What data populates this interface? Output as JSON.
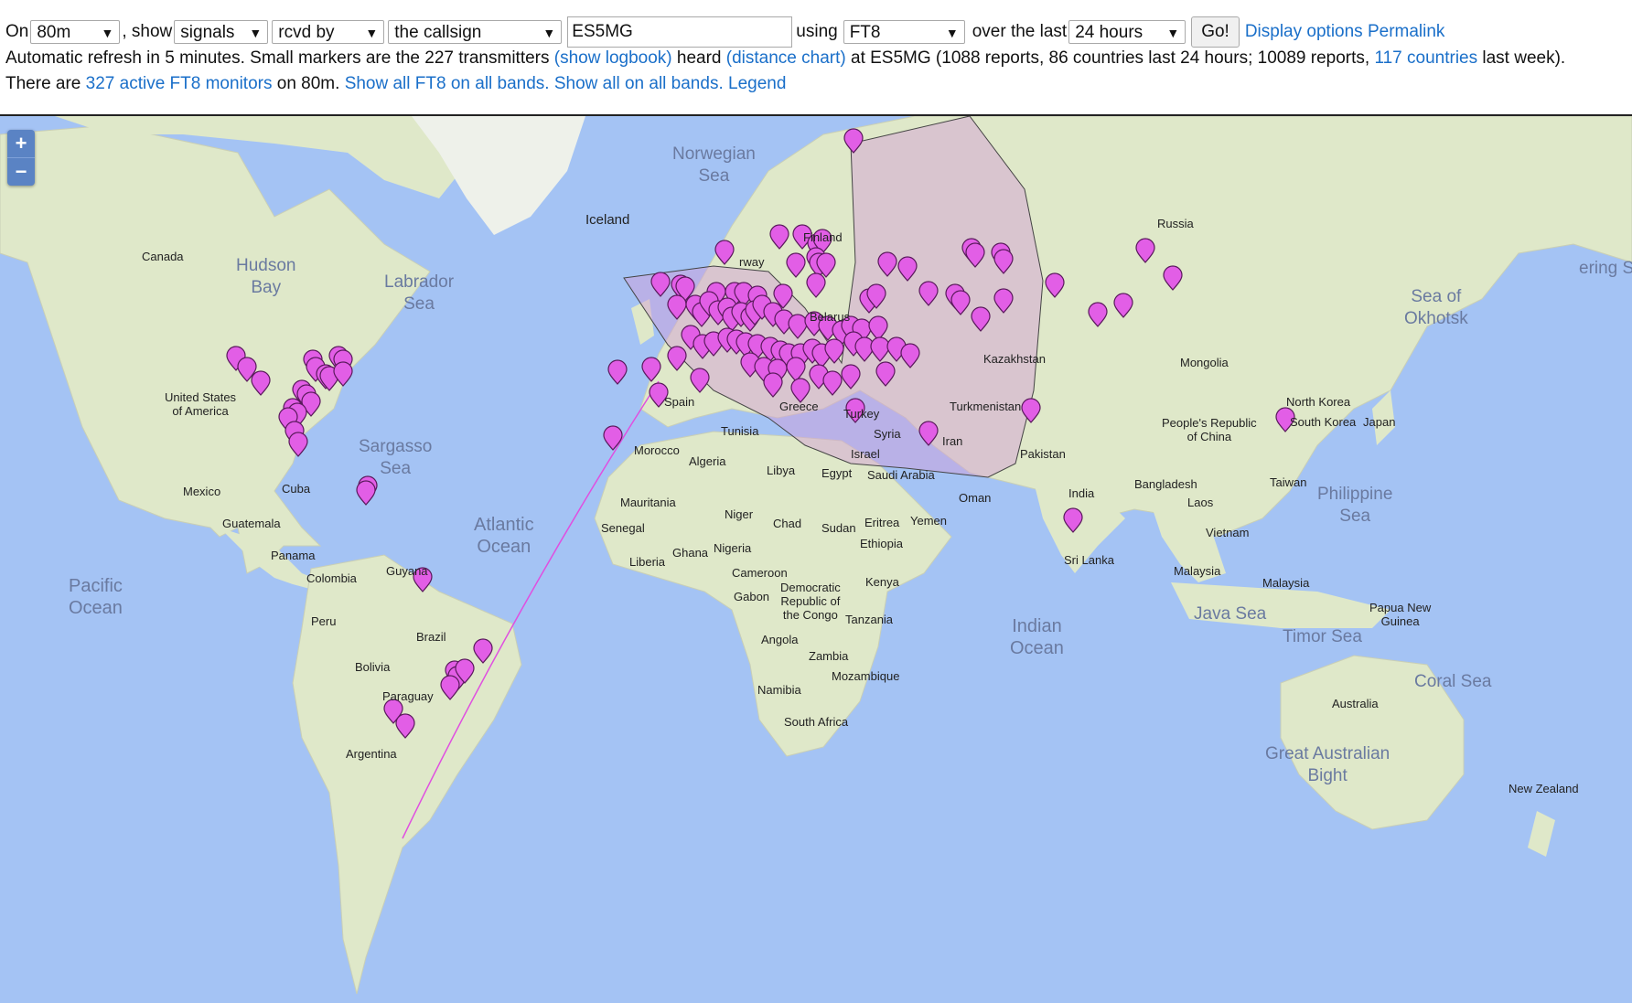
{
  "controls": {
    "on_label": "On",
    "band": "80m",
    "show_label": ", show",
    "show_value": "signals",
    "direction": "rcvd by",
    "subject": "the callsign",
    "callsign": "ES5MG",
    "using_label": "using",
    "mode": "FT8",
    "over_label": "over the last",
    "period": "24 hours",
    "go_label": "Go!",
    "display_options": "Display options",
    "permalink": "Permalink"
  },
  "status": {
    "line1_a": "Automatic refresh in 5 minutes. Small markers are the 227 transmitters ",
    "show_logbook": "(show logbook)",
    "line1_b": " heard ",
    "distance_chart": "(distance chart)",
    "line1_c": " at ES5MG (1088 reports, 86 countries last 24 hours; 10089 reports, ",
    "countries_link": "117 countries",
    "line1_d": " last week).",
    "line2_a": "There are ",
    "monitors_link": "327 active FT8 monitors",
    "line2_b": " on 80m. ",
    "show_ft8_all": "Show all FT8 on all bands.",
    "show_all_all": "Show all on all bands.",
    "legend": "Legend"
  },
  "map": {
    "zoom_in": "+",
    "zoom_out": "−",
    "colors": {
      "water": "#a4c3f4",
      "land": "#dfe8c9",
      "marker": "#e25ee6",
      "marker_outline": "#5a1a5c",
      "range": "#d29bd8"
    },
    "place_labels": {
      "norwegian_sea": "Norwegian\nSea",
      "iceland": "Iceland",
      "hudson_bay": "Hudson\nBay",
      "labrador_sea": "Labrador\nSea",
      "canada": "Canada",
      "usa": "United States\nof America",
      "sargasso_sea": "Sargasso\nSea",
      "mexico": "Mexico",
      "cuba": "Cuba",
      "guatemala": "Guatemala",
      "panama": "Panama",
      "pacific_ocean": "Pacific\nOcean",
      "atlantic_ocean": "Atlantic\nOcean",
      "colombia": "Colombia",
      "guyana": "Guyana",
      "peru": "Peru",
      "brazil": "Brazil",
      "bolivia": "Bolivia",
      "paraguay": "Paraguay",
      "argentina": "Argentina",
      "finland": "Finland",
      "belarus": "Belarus",
      "russia": "Russia",
      "kazakhstan": "Kazakhstan",
      "turkmenistan": "Turkmenistan",
      "mongolia": "Mongolia",
      "syria": "Syria",
      "iran": "Iran",
      "israel": "Israel",
      "pakistan": "Pakistan",
      "tunisia": "Tunisia",
      "morocco": "Morocco",
      "algeria": "Algeria",
      "libya": "Libya",
      "egypt": "Egypt",
      "saudi_arabia": "Saudi Arabia",
      "oman": "Oman",
      "yemen": "Yemen",
      "mauritania": "Mauritania",
      "senegal": "Senegal",
      "niger": "Niger",
      "chad": "Chad",
      "sudan": "Sudan",
      "eritrea": "Eritrea",
      "ethiopia": "Ethiopia",
      "nigeria": "Nigeria",
      "ghana": "Ghana",
      "liberia": "Liberia",
      "cameroon": "Cameroon",
      "gabon": "Gabon",
      "drc": "Democratic\nRepublic of\nthe Congo",
      "kenya": "Kenya",
      "tanzania": "Tanzania",
      "angola": "Angola",
      "zambia": "Zambia",
      "mozambique": "Mozambique",
      "namibia": "Namibia",
      "south_africa": "South Africa",
      "india": "India",
      "sri_lanka": "Sri Lanka",
      "bangladesh": "Bangladesh",
      "laos": "Laos",
      "vietnam": "Vietnam",
      "china": "People's Republic\nof China",
      "north_korea": "North Korea",
      "south_korea": "South Korea",
      "japan": "Japan",
      "taiwan": "Taiwan",
      "philippine_sea": "Philippine\nSea",
      "sea_of_okhotsk": "Sea of\nOkhotsk",
      "bering": "ering Se",
      "malaysia1": "Malaysia",
      "malaysia2": "Malaysia",
      "java_sea": "Java Sea",
      "timor_sea": "Timor Sea",
      "png": "Papua New\nGuinea",
      "coral_sea": "Coral Sea",
      "australia": "Australia",
      "great_australian_bight": "Great Australian\nBight",
      "new_zealand": "New Zealand",
      "indian_ocean": "Indian\nOcean",
      "greece": "Greece",
      "turkey": "Turkey",
      "spain": "Spain",
      "norway": "rway"
    }
  }
}
